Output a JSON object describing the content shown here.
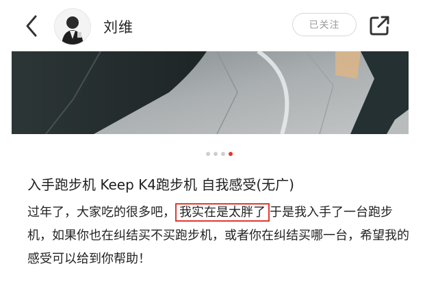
{
  "header": {
    "back_icon": "chevron-left-icon",
    "avatar_icon": "user-avatar",
    "username": "刘维",
    "follow_label": "已关注",
    "share_icon": "share-external-icon"
  },
  "carousel": {
    "total": 4,
    "active_index": 3,
    "active_color": "#e0382f",
    "inactive_color": "#cfcfcf"
  },
  "post": {
    "title": "入手跑步机 Keep K4跑步机 自我感受(无广)",
    "body_before": "过年了，大家吃的很多吧，",
    "body_highlight": "我实在是太胖了",
    "body_after": "于是我入手了一台跑步机，如果你也在纠结买不买跑步机，或者你在纠结买哪一台，希望我的感受可以给到你帮助！"
  }
}
